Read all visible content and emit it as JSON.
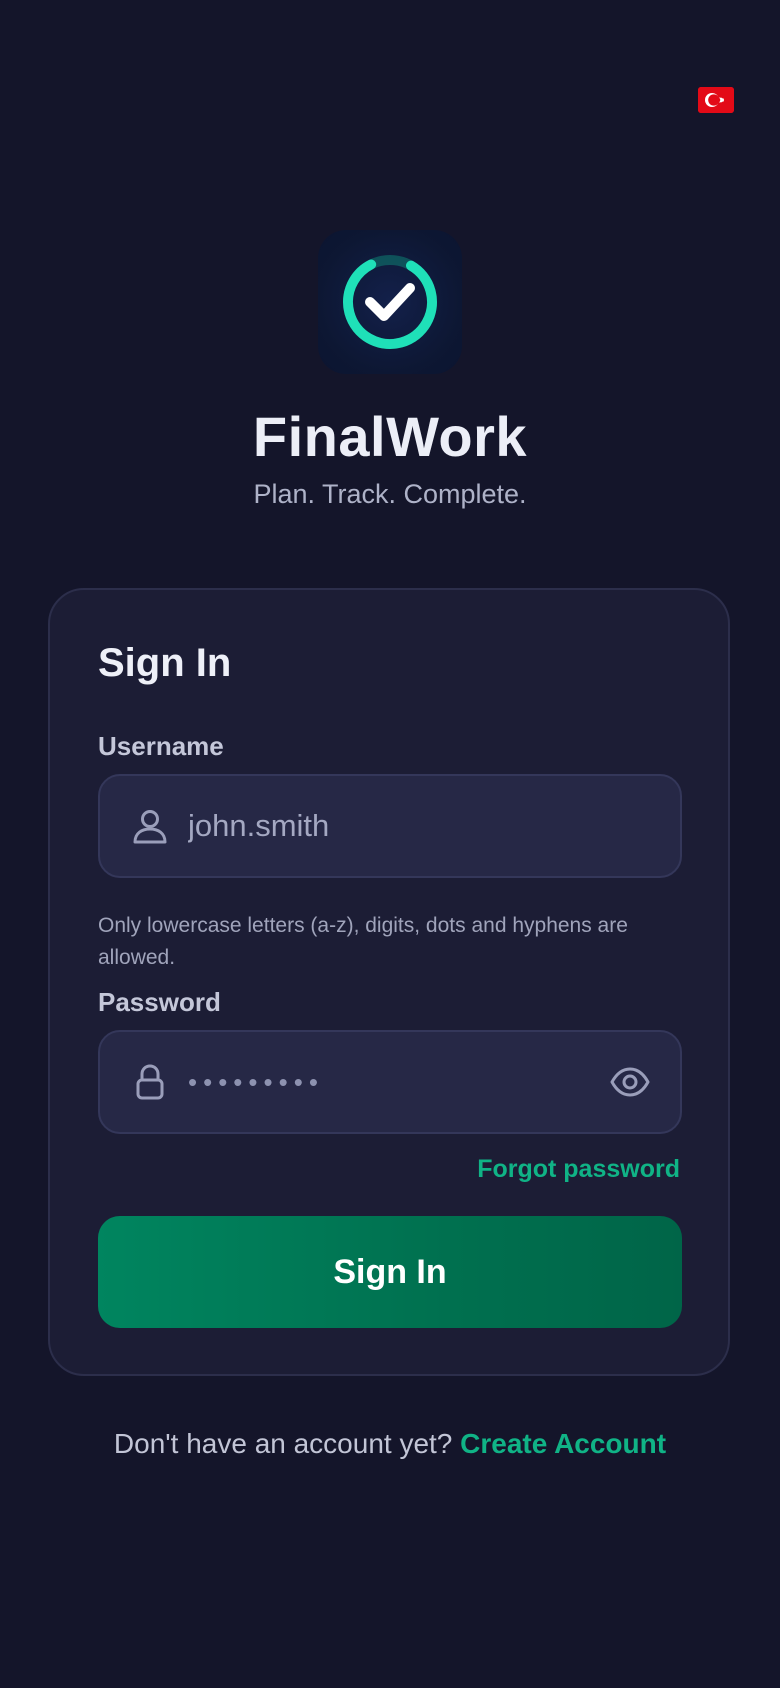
{
  "header": {
    "language_flag_icon": "turkey-flag-icon"
  },
  "brand": {
    "app_name": "FinalWork",
    "tagline": "Plan. Track. Complete.",
    "accent_color": "#10b386",
    "logo_icon": "check-circle-progress-icon"
  },
  "form": {
    "title": "Sign In",
    "username": {
      "label": "Username",
      "value": "john.smith",
      "icon": "user-icon",
      "helper": "Only lowercase letters (a-z), digits, dots and hyphens are allowed."
    },
    "password": {
      "label": "Password",
      "value": "•••••••••",
      "icon": "lock-icon",
      "toggle_icon": "eye-icon"
    },
    "forgot_label": "Forgot password",
    "submit_label": "Sign In",
    "submit_color": "#00855f"
  },
  "footer": {
    "prompt": "Don't have an account yet?",
    "create_label": "Create Account"
  }
}
